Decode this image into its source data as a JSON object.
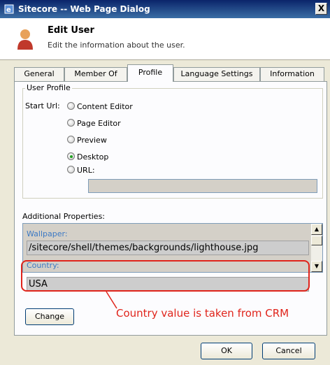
{
  "window": {
    "title": "Sitecore -- Web Page Dialog",
    "close_label": "X"
  },
  "header": {
    "title": "Edit User",
    "subtitle": "Edit the information about the user."
  },
  "tabs": [
    {
      "label": "General"
    },
    {
      "label": "Member Of"
    },
    {
      "label": "Profile"
    },
    {
      "label": "Language Settings"
    },
    {
      "label": "Information"
    }
  ],
  "user_profile": {
    "legend": "User Profile",
    "start_url_label": "Start Url:",
    "options": [
      {
        "label": "Content Editor",
        "checked": false
      },
      {
        "label": "Page Editor",
        "checked": false
      },
      {
        "label": "Preview",
        "checked": false
      },
      {
        "label": "Desktop",
        "checked": true
      },
      {
        "label": "URL:",
        "checked": false
      }
    ],
    "url_value": ""
  },
  "additional_properties": {
    "label": "Additional Properties:",
    "items": [
      {
        "label": "Wallpaper:",
        "value": "/sitecore/shell/themes/backgrounds/lighthouse.jpg"
      },
      {
        "label": "Country:",
        "value": "USA"
      }
    ]
  },
  "annotation": {
    "text": "Country value is taken from CRM",
    "color": "#e0241b"
  },
  "buttons": {
    "change": "Change",
    "ok": "OK",
    "cancel": "Cancel"
  },
  "colors": {
    "titlebar": "#0a246a",
    "dialog_bg": "#ece9d8",
    "accent_link": "#3c79c4"
  }
}
